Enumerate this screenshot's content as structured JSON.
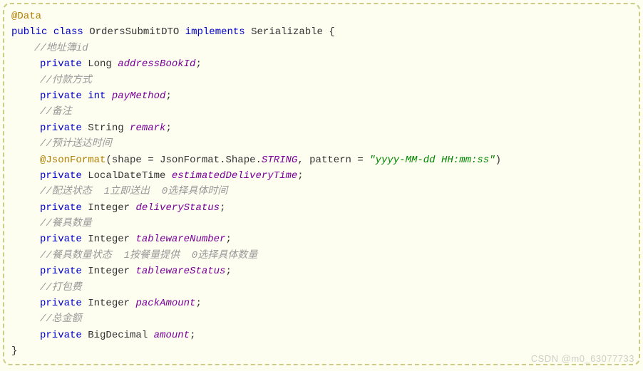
{
  "annotations": {
    "data": "@Data",
    "jsonFormat": "@JsonFormat"
  },
  "keywords": {
    "public": "public",
    "class": "class",
    "implements": "implements",
    "private": "private",
    "int": "int"
  },
  "classDecl": {
    "name": "OrdersSubmitDTO",
    "implements": "Serializable",
    "openBrace": "{",
    "closeBrace": "}"
  },
  "comments": {
    "addressBookId": "//地址簿id",
    "payMethod": "//付款方式",
    "remark": "//备注",
    "estimatedDeliveryTime": "//预计送达时间",
    "deliveryStatus": "//配送状态  1立即送出  0选择具体时间",
    "tablewareNumber": "//餐具数量",
    "tablewareStatus": "//餐具数量状态  1按餐量提供  0选择具体数量",
    "packAmount": "//打包费",
    "amount": "//总金额"
  },
  "types": {
    "Long": "Long",
    "String": "String",
    "LocalDateTime": "LocalDateTime",
    "Integer": "Integer",
    "BigDecimal": "BigDecimal"
  },
  "fields": {
    "addressBookId": "addressBookId",
    "payMethod": "payMethod",
    "remark": "remark",
    "estimatedDeliveryTime": "estimatedDeliveryTime",
    "deliveryStatus": "deliveryStatus",
    "tablewareNumber": "tablewareNumber",
    "tablewareStatus": "tablewareStatus",
    "packAmount": "packAmount",
    "amount": "amount"
  },
  "jsonFormat": {
    "open": "(",
    "shapeKey": "shape",
    "equals": " = ",
    "shapeClass": "JsonFormat",
    "dot": ".",
    "shapeInner": "Shape",
    "stringConst": "STRING",
    "comma": ",",
    "patternKey": " pattern",
    "patternValue": "\"yyyy-MM-dd HH:mm:ss\"",
    "close": ")"
  },
  "punct": {
    "semicolon": ";"
  },
  "watermark": "CSDN @m0_63077733"
}
